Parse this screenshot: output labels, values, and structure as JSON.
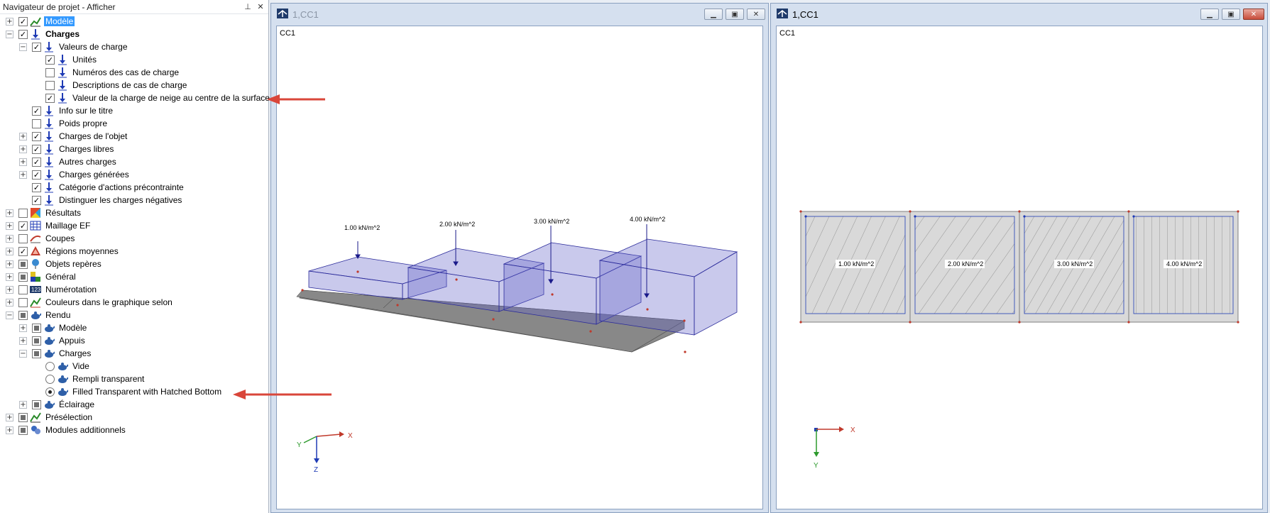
{
  "navigator": {
    "title": "Navigateur de projet - Afficher",
    "pin": "⊥",
    "close": "✕",
    "items": [
      {
        "label": "Modèle",
        "level": 0,
        "exp": "+",
        "chk": "checked",
        "icon": "model-icon",
        "selected": true,
        "bold": false
      },
      {
        "label": "Charges",
        "level": 0,
        "exp": "-",
        "chk": "checked",
        "icon": "load-icon",
        "bold": true
      },
      {
        "label": "Valeurs de charge",
        "level": 1,
        "exp": "-",
        "chk": "checked",
        "icon": "load-icon"
      },
      {
        "label": "Unités",
        "level": 2,
        "exp": "",
        "chk": "checked",
        "icon": "load-icon"
      },
      {
        "label": "Numéros des cas de charge",
        "level": 2,
        "exp": "",
        "chk": "unchecked",
        "icon": "load-icon"
      },
      {
        "label": "Descriptions de cas de charge",
        "level": 2,
        "exp": "",
        "chk": "unchecked",
        "icon": "load-icon"
      },
      {
        "label": "Valeur de la charge de neige au centre de la surface",
        "level": 2,
        "exp": "",
        "chk": "checked",
        "icon": "load-icon"
      },
      {
        "label": "Info sur le titre",
        "level": 1,
        "exp": "",
        "chk": "checked",
        "icon": "load-icon"
      },
      {
        "label": "Poids propre",
        "level": 1,
        "exp": "",
        "chk": "unchecked",
        "icon": "load-icon"
      },
      {
        "label": "Charges de l'objet",
        "level": 1,
        "exp": "+",
        "chk": "checked",
        "icon": "load-icon"
      },
      {
        "label": "Charges libres",
        "level": 1,
        "exp": "+",
        "chk": "checked",
        "icon": "load-icon"
      },
      {
        "label": "Autres charges",
        "level": 1,
        "exp": "+",
        "chk": "checked",
        "icon": "load-icon"
      },
      {
        "label": "Charges générées",
        "level": 1,
        "exp": "+",
        "chk": "checked",
        "icon": "load-icon"
      },
      {
        "label": "Catégorie d'actions précontrainte",
        "level": 1,
        "exp": "",
        "chk": "checked",
        "icon": "load-icon"
      },
      {
        "label": "Distinguer les charges négatives",
        "level": 1,
        "exp": "",
        "chk": "checked",
        "icon": "load-icon"
      },
      {
        "label": "Résultats",
        "level": 0,
        "exp": "+",
        "chk": "unchecked",
        "icon": "results-icon"
      },
      {
        "label": "Maillage EF",
        "level": 0,
        "exp": "+",
        "chk": "checked",
        "icon": "mesh-icon"
      },
      {
        "label": "Coupes",
        "level": 0,
        "exp": "+",
        "chk": "unchecked",
        "icon": "section-icon"
      },
      {
        "label": "Régions moyennes",
        "level": 0,
        "exp": "+",
        "chk": "checked",
        "icon": "region-icon"
      },
      {
        "label": "Objets repères",
        "level": 0,
        "exp": "+",
        "chk": "partial",
        "icon": "marker-icon"
      },
      {
        "label": "Général",
        "level": 0,
        "exp": "+",
        "chk": "partial",
        "icon": "general-icon"
      },
      {
        "label": "Numérotation",
        "level": 0,
        "exp": "+",
        "chk": "unchecked",
        "icon": "numbering-icon"
      },
      {
        "label": "Couleurs dans le graphique selon",
        "level": 0,
        "exp": "+",
        "chk": "unchecked",
        "icon": "colors-icon"
      },
      {
        "label": "Rendu",
        "level": 0,
        "exp": "-",
        "chk": "partial",
        "icon": "teapot-icon"
      },
      {
        "label": "Modèle",
        "level": 1,
        "exp": "+",
        "chk": "partial",
        "icon": "teapot-icon"
      },
      {
        "label": "Appuis",
        "level": 1,
        "exp": "+",
        "chk": "partial",
        "icon": "teapot-icon"
      },
      {
        "label": "Charges",
        "level": 1,
        "exp": "-",
        "chk": "partial",
        "icon": "teapot-icon"
      },
      {
        "label": "Vide",
        "level": 2,
        "exp": "",
        "chk": "radio-off",
        "icon": "teapot-icon"
      },
      {
        "label": "Rempli transparent",
        "level": 2,
        "exp": "",
        "chk": "radio-off",
        "icon": "teapot-icon"
      },
      {
        "label": "Filled Transparent with Hatched Bottom",
        "level": 2,
        "exp": "",
        "chk": "radio-on",
        "icon": "teapot-icon"
      },
      {
        "label": "Éclairage",
        "level": 1,
        "exp": "+",
        "chk": "partial",
        "icon": "teapot-icon"
      },
      {
        "label": "Présélection",
        "level": 0,
        "exp": "+",
        "chk": "partial",
        "icon": "preselection-icon"
      },
      {
        "label": "Modules additionnels",
        "level": 0,
        "exp": "+",
        "chk": "partial",
        "icon": "addons-icon"
      }
    ]
  },
  "window_left": {
    "title": "1,CC1",
    "corner_label": "CC1",
    "loads": [
      "1.00 kN/m^2",
      "2.00 kN/m^2",
      "3.00 kN/m^2",
      "4.00 kN/m^2"
    ],
    "axes": {
      "x": "X",
      "y": "Y",
      "z": "Z"
    }
  },
  "window_right": {
    "title": "1,CC1",
    "corner_label": "CC1",
    "loads": [
      "1.00 kN/m^2",
      "2.00 kN/m^2",
      "3.00 kN/m^2",
      "4.00 kN/m^2"
    ],
    "axes": {
      "x": "X",
      "y": "Y"
    }
  },
  "colors": {
    "selection": "#3399ff",
    "load_fill": "#6464c8",
    "arrow": "#d9463a",
    "window_active_title": "#000000",
    "window_inactive_title": "#8a95a5"
  }
}
